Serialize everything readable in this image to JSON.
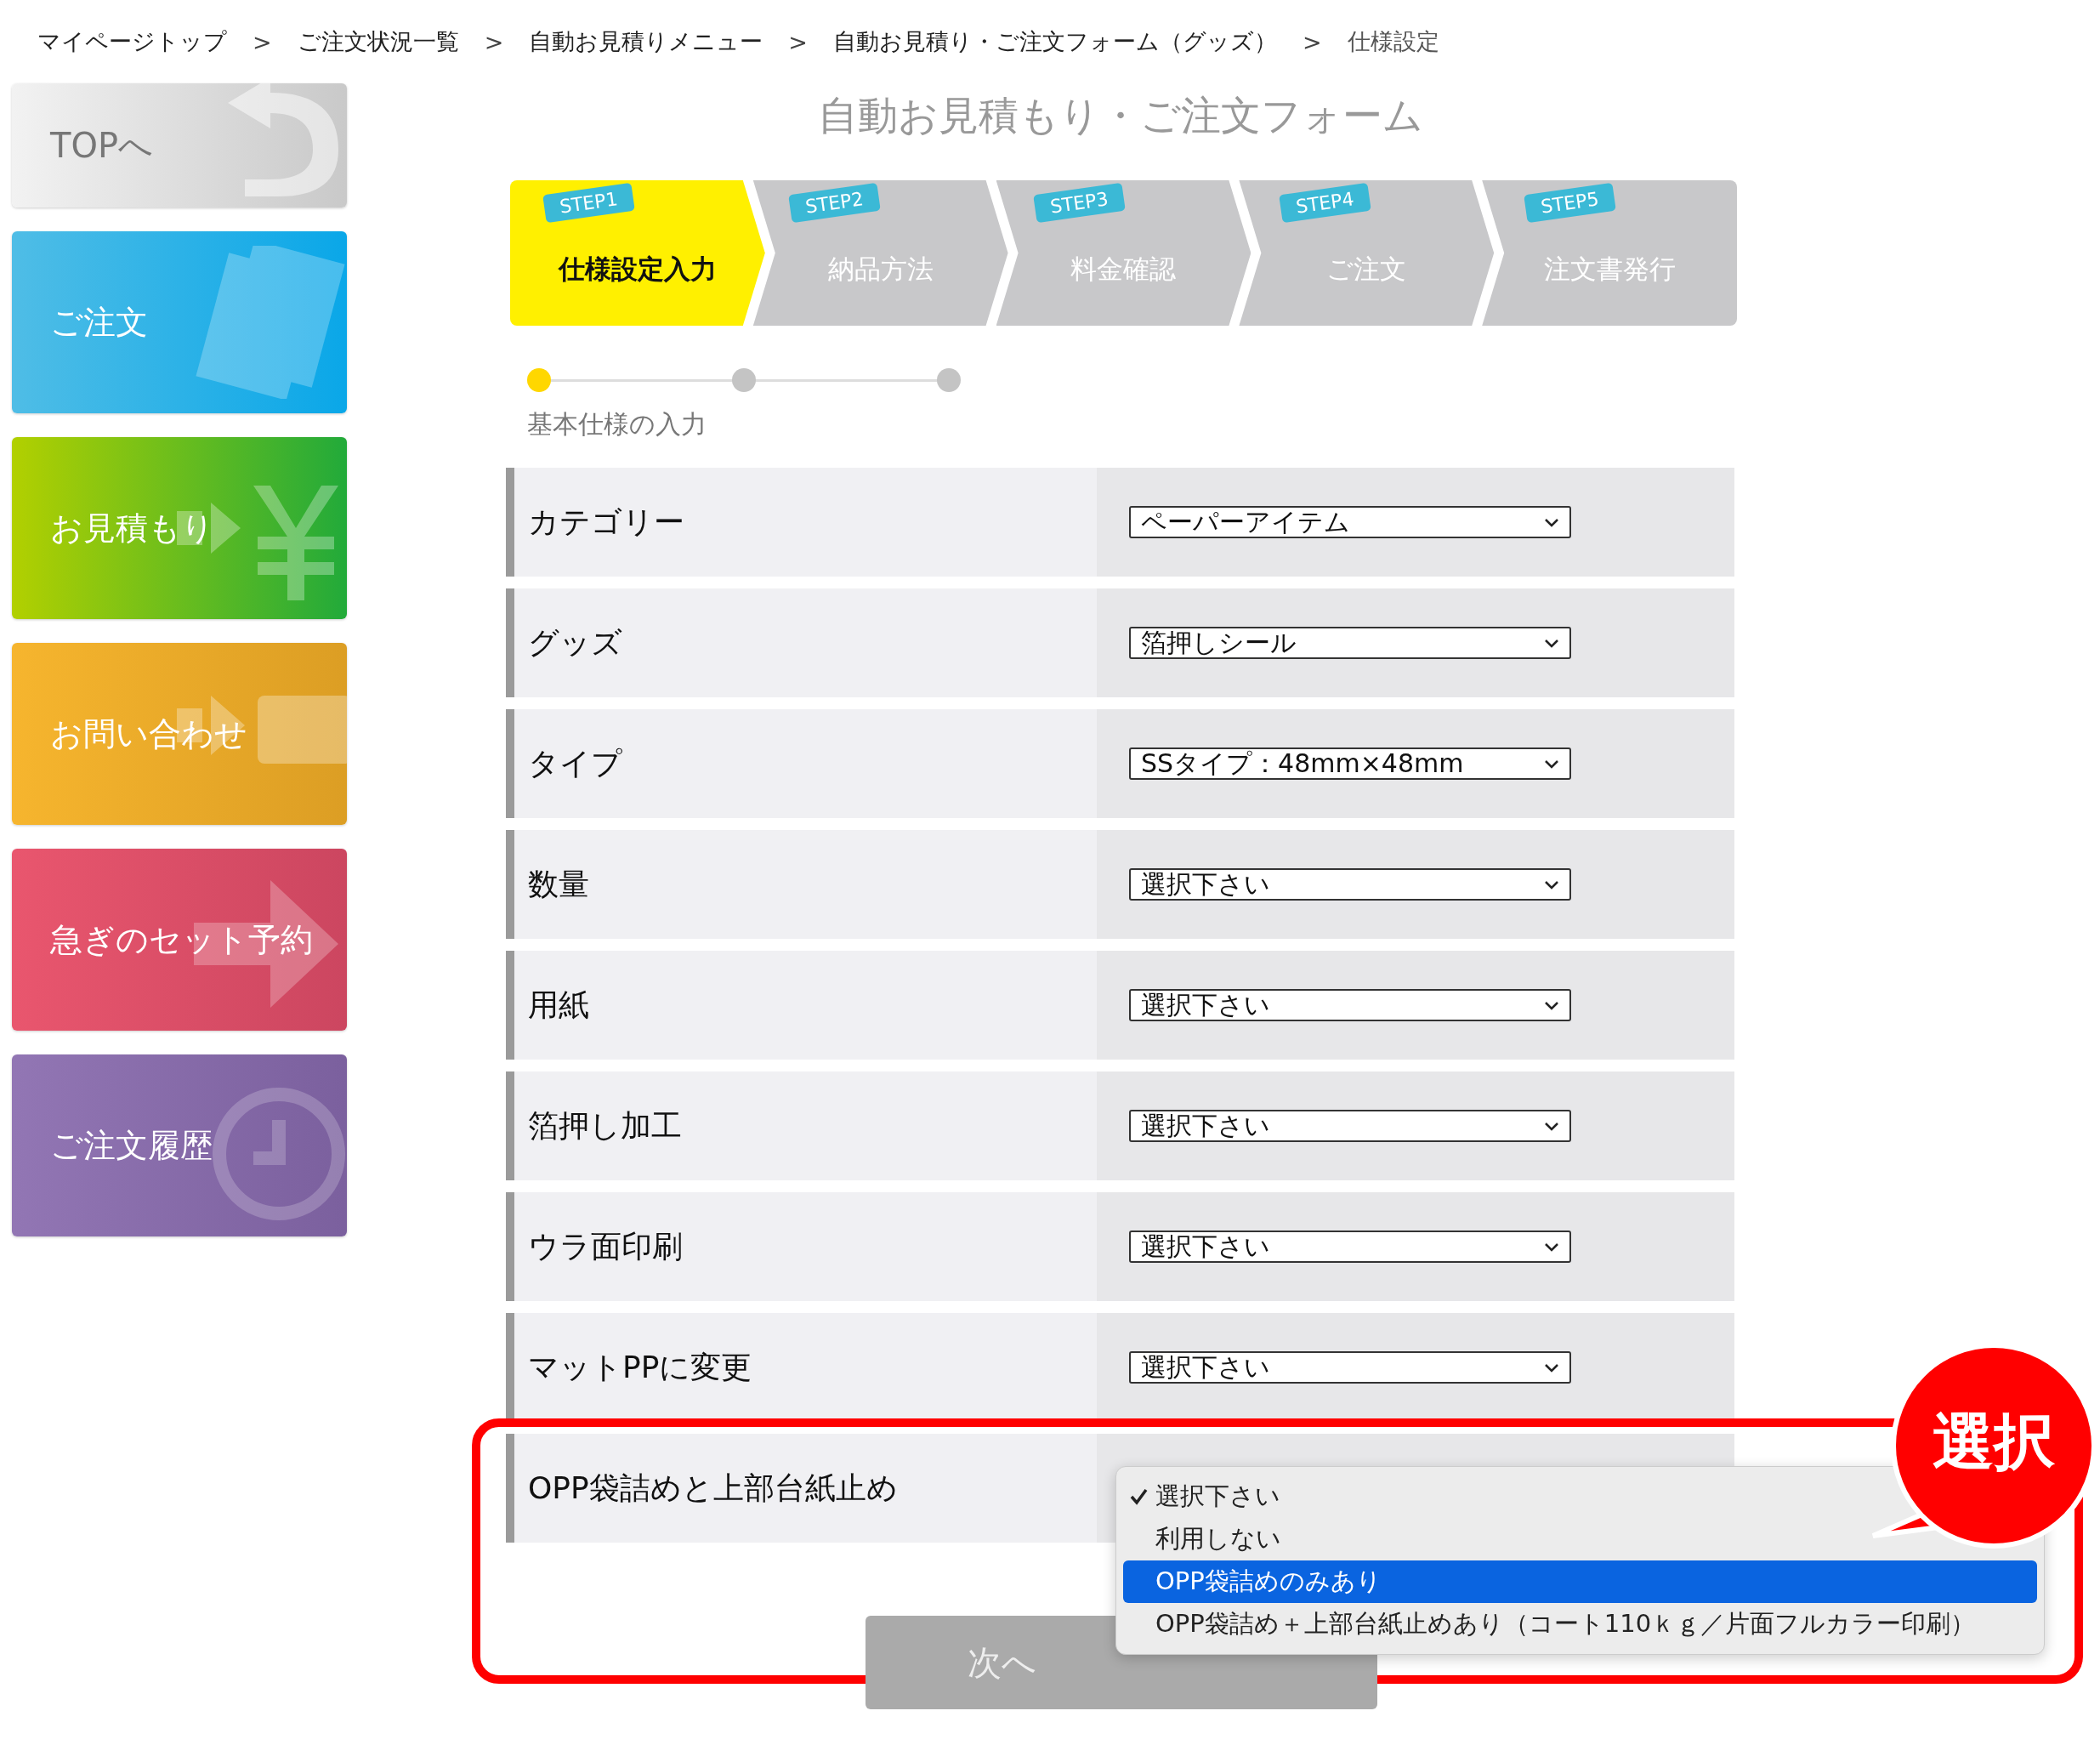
{
  "breadcrumbs": [
    {
      "label": "マイページトップ",
      "separator": ">"
    },
    {
      "label": "ご注文状況一覧",
      "separator": ">"
    },
    {
      "label": "自動お見積りメニュー",
      "separator": ">"
    },
    {
      "label": "自動お見積り・ご注文フォーム（グッズ）",
      "separator": ">"
    },
    {
      "label": "仕様設定"
    }
  ],
  "sidebar": {
    "items": [
      {
        "label": "TOPへ",
        "kind": "top"
      },
      {
        "label": "ご注文",
        "kind": "order"
      },
      {
        "label": "お見積もり",
        "kind": "estimate"
      },
      {
        "label": "お問い合わせ",
        "kind": "contact"
      },
      {
        "label": "急ぎのセット予約",
        "kind": "rush"
      },
      {
        "label": "ご注文履歴",
        "kind": "history"
      }
    ]
  },
  "title": "自動お見積もり・ご注文フォーム",
  "steps": [
    {
      "badge": "STEP1",
      "label": "仕様設定入力",
      "selected": true
    },
    {
      "badge": "STEP2",
      "label": "納品方法",
      "selected": false
    },
    {
      "badge": "STEP3",
      "label": "料金確認",
      "selected": false
    },
    {
      "badge": "STEP4",
      "label": "ご注文",
      "selected": false
    },
    {
      "badge": "STEP5",
      "label": "注文書発行",
      "selected": false
    }
  ],
  "progress": {
    "dots": [
      {
        "selected": true
      },
      {
        "selected": false
      },
      {
        "selected": false
      }
    ],
    "label": "基本仕様の入力"
  },
  "form": {
    "rows": [
      {
        "label": "カテゴリー",
        "value": "ペーパーアイテム"
      },
      {
        "label": "グッズ",
        "value": "箔押しシール"
      },
      {
        "label": "タイプ",
        "value": "SSタイプ：48mm×48mm"
      },
      {
        "label": "数量",
        "value": "選択下さい"
      },
      {
        "label": "用紙",
        "value": "選択下さい"
      },
      {
        "label": "箔押し加工",
        "value": "選択下さい"
      },
      {
        "label": "ウラ面印刷",
        "value": "選択下さい"
      },
      {
        "label": "マットPPに変更",
        "value": "選択下さい"
      },
      {
        "label": "OPP袋詰めと上部台紙止め",
        "menu": [
          {
            "label": "選択下さい",
            "checked": true,
            "selected": false
          },
          {
            "label": "利用しない",
            "checked": false,
            "selected": false
          },
          {
            "label": "OPP袋詰めのみあり",
            "checked": false,
            "selected": true
          },
          {
            "label": "OPP袋詰め＋上部台紙止めあり（コート110ｋｇ／片面フルカラー印刷）",
            "checked": false,
            "selected": false
          }
        ]
      }
    ]
  },
  "callout": "選択",
  "next_button": "次へ"
}
